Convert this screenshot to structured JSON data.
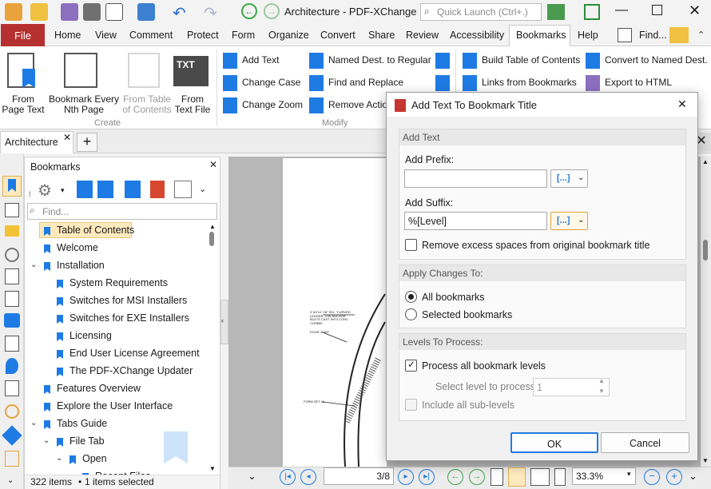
{
  "window": {
    "title": "Architecture - PDF-XChange E...",
    "search_placeholder": "Quick Launch (Ctrl+.)",
    "find_label": "Find..."
  },
  "ribbon_tabs": [
    "File",
    "Home",
    "View",
    "Comment",
    "Protect",
    "Form",
    "Organize",
    "Convert",
    "Share",
    "Review",
    "Accessibility",
    "Bookmarks",
    "Help"
  ],
  "ribbon": {
    "create": {
      "from_page_text": "From\nPage Text",
      "bookmark_every_nth": "Bookmark Every\nNth Page",
      "from_table": "From Table\nof Contents",
      "from_text_file": "From\nText File",
      "group": "Create"
    },
    "modify": {
      "add_text": "Add Text",
      "change_case": "Change Case",
      "change_zoom": "Change Zoom",
      "named_dest": "Named Dest. to Regular",
      "find_replace": "Find and Replace",
      "remove_action": "Remove Actio",
      "group": "Modify"
    },
    "other": {
      "build_toc": "Build Table of Contents",
      "links_from_bookmarks": "Links from Bookmarks",
      "convert_named": "Convert to Named Dest.",
      "export_html": "Export to HTML"
    }
  },
  "doc_tab": "Architecture",
  "bookmarks": {
    "title": "Bookmarks",
    "find_placeholder": "Find...",
    "items": [
      "Table of Contents",
      "Welcome",
      "Installation",
      "System Requirements",
      "Switches for MSI Installers",
      "Switches for EXE Installers",
      "Licensing",
      "End User License Agreement",
      "The PDF-XChange Updater",
      "Features Overview",
      "Explore the User Interface",
      "Tabs Guide",
      "File Tab",
      "Open",
      "Recent Files"
    ],
    "status_count": "322 items",
    "status_selected": "1 items selected"
  },
  "nav": {
    "page": "3/8",
    "zoom": "33.3%"
  },
  "drawing_notes": {
    "n1": "3 3/4\"x1 7/8\" SCL \"CURVED",
    "n2": "LEDGER, C/W ANCHOR",
    "n3": "BOLTS CAST INTO CONC",
    "n4": "CORBEL",
    "n5": "POUR JOINT",
    "n6": "FORM SET #2"
  },
  "dialog": {
    "title": "Add Text To Bookmark Title",
    "add_text_section": "Add Text",
    "prefix_label": "Add Prefix:",
    "prefix_value": "",
    "suffix_label": "Add Suffix:",
    "suffix_value": "%[Level]",
    "macro_glyph": "[...]",
    "remove_spaces": "Remove excess spaces from original bookmark title",
    "apply_section": "Apply Changes To:",
    "all_bookmarks": "All bookmarks",
    "selected_bookmarks": "Selected bookmarks",
    "levels_section": "Levels To Process:",
    "process_all": "Process all bookmark levels",
    "select_level_label": "Select level to process:",
    "select_level_value": "1",
    "include_sublevels": "Include all sub-levels",
    "ok": "OK",
    "cancel": "Cancel"
  },
  "colors": {
    "accent": "#1e7be4",
    "file_tab": "#b5312f",
    "highlight": "#fde9bd"
  }
}
